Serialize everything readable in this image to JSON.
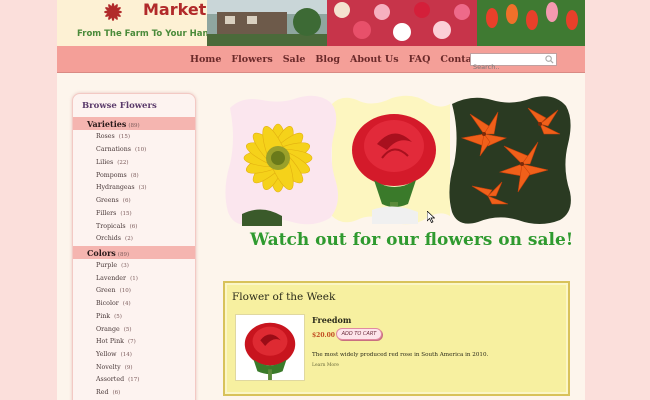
{
  "header": {
    "logo_word": "Market",
    "tagline": "From The Farm To Your Hand"
  },
  "nav": {
    "items": [
      "Home",
      "Flowers",
      "Sale",
      "Blog",
      "About Us",
      "FAQ",
      "Contact Us"
    ],
    "search_placeholder": "Search.."
  },
  "sidebar": {
    "title": "Browse Flowers",
    "varieties": {
      "label": "Varieties",
      "count": "(89)",
      "items": [
        {
          "label": "Roses",
          "count": "(15)"
        },
        {
          "label": "Carnations",
          "count": "(10)"
        },
        {
          "label": "Lilies",
          "count": "(22)"
        },
        {
          "label": "Pompoms",
          "count": "(8)"
        },
        {
          "label": "Hydrangeas",
          "count": "(3)"
        },
        {
          "label": "Greens",
          "count": "(6)"
        },
        {
          "label": "Fillers",
          "count": "(15)"
        },
        {
          "label": "Tropicals",
          "count": "(6)"
        },
        {
          "label": "Orchids",
          "count": "(2)"
        }
      ]
    },
    "colors": {
      "label": "Colors",
      "count": "(89)",
      "items": [
        {
          "label": "Purple",
          "count": "(3)"
        },
        {
          "label": "Lavender",
          "count": "(1)"
        },
        {
          "label": "Green",
          "count": "(10)"
        },
        {
          "label": "Bicolor",
          "count": "(4)"
        },
        {
          "label": "Pink",
          "count": "(5)"
        },
        {
          "label": "Orange",
          "count": "(5)"
        },
        {
          "label": "Hot Pink",
          "count": "(7)"
        },
        {
          "label": "Yellow",
          "count": "(14)"
        },
        {
          "label": "Novelty",
          "count": "(9)"
        },
        {
          "label": "Assorted",
          "count": "(17)"
        },
        {
          "label": "Red",
          "count": "(6)"
        }
      ]
    }
  },
  "main": {
    "sale_heading": "Watch out for our flowers on sale!",
    "flower_of_week": {
      "title": "Flower of the Week",
      "name": "Freedom",
      "price": "$20.00",
      "add_to_cart": "ADD TO CART",
      "description": "The most widely produced red rose in South America in 2010.",
      "learn_more": "Learn More"
    }
  },
  "colors": {
    "page_bg": "#fbdfdb",
    "nav_bg": "#f49f98",
    "sale_green": "#2f9a2f",
    "fow_bg": "#f7f0a0"
  }
}
